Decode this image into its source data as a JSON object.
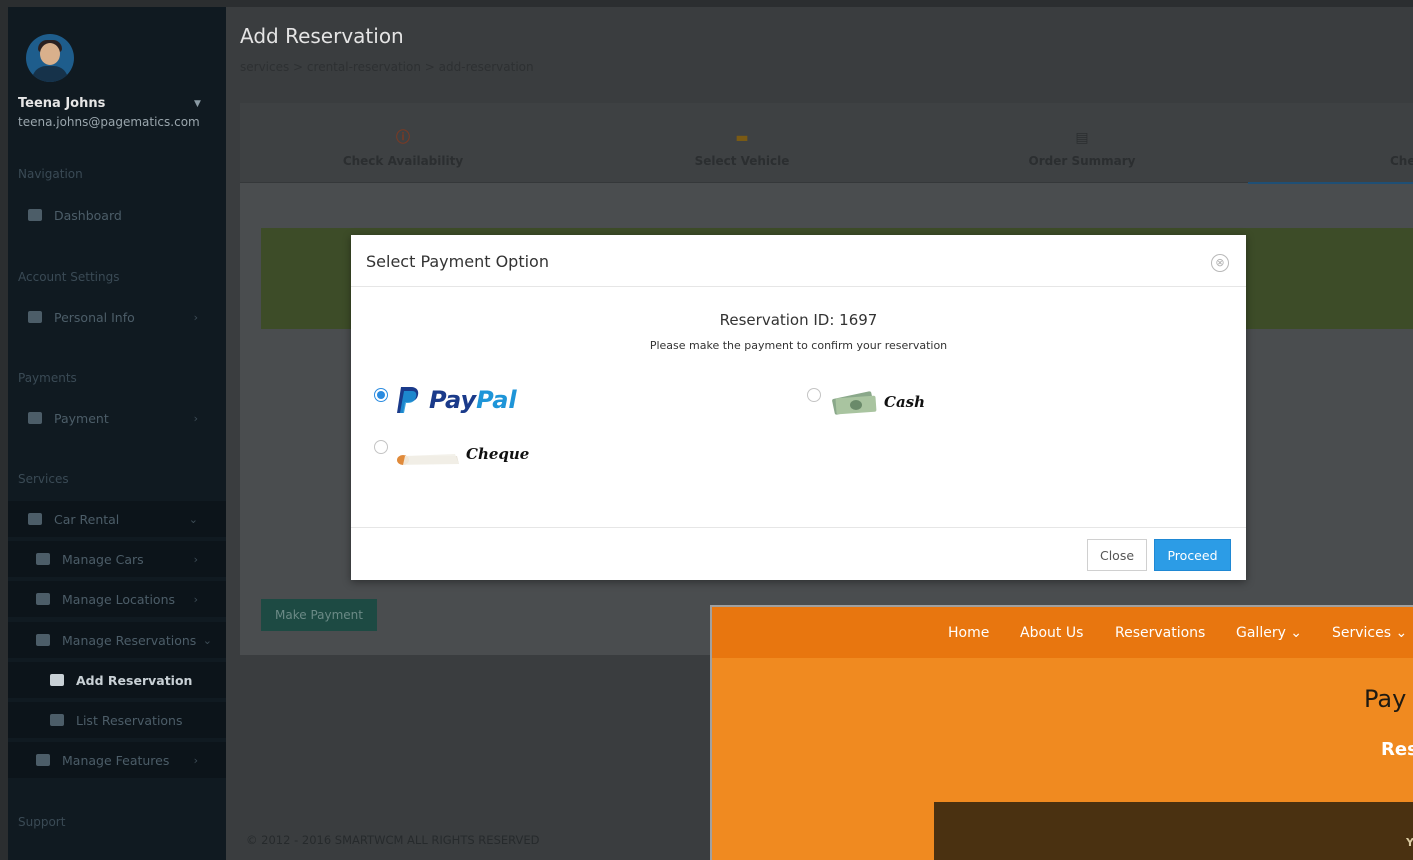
{
  "user": {
    "name": "Teena Johns",
    "email": "teena.johns@pagematics.com"
  },
  "sidebar": {
    "sections": [
      "Navigation",
      "Account Settings",
      "Payments",
      "Services",
      "Support"
    ],
    "items": {
      "dashboard": "Dashboard",
      "personal_info": "Personal Info",
      "payment": "Payment",
      "car_rental": "Car Rental",
      "manage_cars": "Manage Cars",
      "manage_locations": "Manage Locations",
      "manage_reservations": "Manage Reservations",
      "add_reservation": "Add Reservation",
      "list_reservations": "List Reservations",
      "manage_features": "Manage Features"
    }
  },
  "page": {
    "title": "Add Reservation",
    "breadcrumb": "services  >  crental-reservation  >  add-reservation",
    "steps": [
      "Check Availability",
      "Select Vehicle",
      "Order Summary",
      "Che"
    ],
    "make_payment": "Make Payment",
    "footer": "© 2012 - 2016 SMARTWCM ALL RIGHTS RESERVED"
  },
  "modal": {
    "title": "Select Payment Option",
    "reservation_id": "Reservation ID: 1697",
    "note": "Please make the payment to confirm your reservation",
    "options": {
      "paypal_pay": "Pay",
      "paypal_pal": "Pal",
      "cash": "Cash",
      "cheque": "Cheque"
    },
    "selected": "paypal",
    "close_label": "Close",
    "proceed_label": "Proceed",
    "close_icon": "⊗"
  },
  "site": {
    "nav": [
      "Home",
      "About Us",
      "Reservations",
      "Gallery  ⌄",
      "Services  ⌄"
    ],
    "heading": "Pay",
    "subheading": "Res",
    "box_text": "Y"
  },
  "colors": {
    "accent": "#2c9ce6",
    "orange": "#f08a20",
    "sidebar": "#101a21"
  }
}
